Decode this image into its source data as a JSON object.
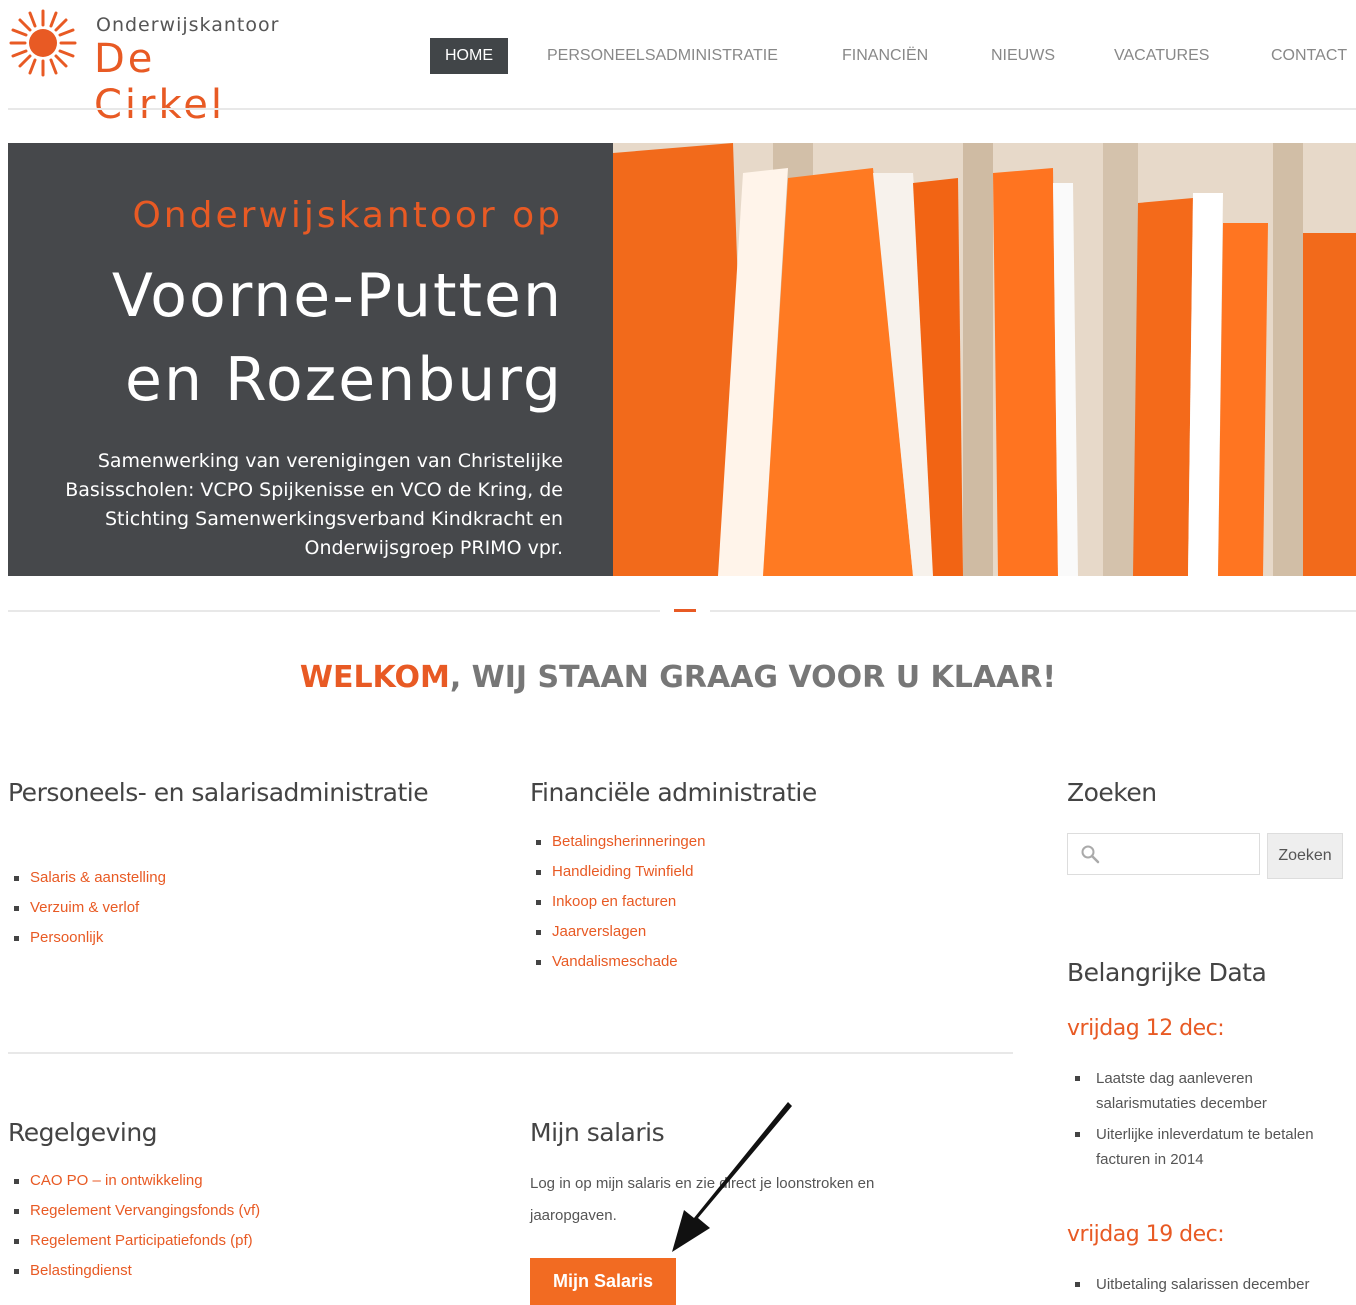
{
  "logo": {
    "small": "Onderwijskantoor",
    "big": "De Cirkel"
  },
  "nav": {
    "items": [
      {
        "label": "HOME"
      },
      {
        "label": "PERSONEELSADMINISTRATIE"
      },
      {
        "label": "FINANCIËN"
      },
      {
        "label": "NIEUWS"
      },
      {
        "label": "VACATURES"
      },
      {
        "label": "CONTACT"
      }
    ]
  },
  "hero": {
    "subtitle": "Onderwijskantoor  op",
    "title_line1": "Voorne-Putten",
    "title_line2": "en  Rozenburg",
    "description": "Samenwerking van verenigingen van Christelijke Basisscholen: VCPO Spijkenisse en VCO de Kring, de Stichting Samenwerkingsverband Kindkracht en Onderwijsgroep PRIMO vpr."
  },
  "welcome": {
    "accent": "WELKOM",
    "rest": ", WIJ STAAN GRAAG VOOR U KLAAR!"
  },
  "personeel": {
    "title": "Personeels- en salarisadministratie",
    "links": [
      "Salaris & aanstelling",
      "Verzuim & verlof",
      "Persoonlijk"
    ]
  },
  "financieel": {
    "title": "Financiële administratie",
    "links": [
      "Betalingsherinneringen",
      "Handleiding Twinfield",
      "Inkoop en facturen",
      "Jaarverslagen",
      "Vandalismeschade"
    ]
  },
  "regelgeving": {
    "title": "Regelgeving",
    "links": [
      "CAO PO – in ontwikkeling",
      "Regelement Vervangingsfonds (vf)",
      "Regelement Participatiefonds (pf)",
      "Belastingdienst"
    ]
  },
  "salaris": {
    "title": "Mijn salaris",
    "text": "Log in op mijn salaris en zie direct je loonstroken en jaaropgaven.",
    "button": "Mijn Salaris"
  },
  "search": {
    "title": "Zoeken",
    "placeholder": "",
    "button": "Zoeken"
  },
  "data": {
    "title": "Belangrijke Data",
    "groups": [
      {
        "date": "vrijdag 12 dec:",
        "items": [
          "Laatste dag aanleveren salarismutaties december",
          "Uiterlijke inleverdatum te betalen facturen in 2014"
        ]
      },
      {
        "date": "vrijdag 19 dec:",
        "items": [
          "Uitbetaling salarissen december"
        ]
      }
    ]
  },
  "colors": {
    "accent": "#e85a24",
    "dark": "#46484b",
    "button": "#f26b22"
  }
}
